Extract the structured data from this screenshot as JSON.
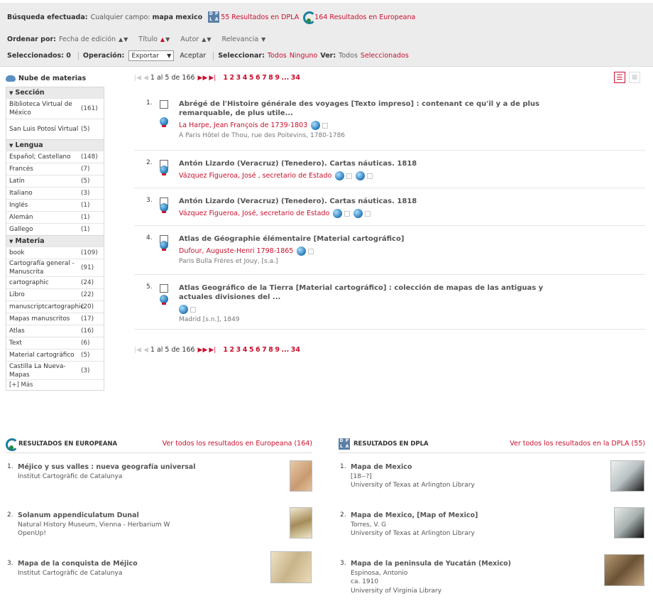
{
  "search": {
    "label": "Búsqueda efectuada:",
    "field": "Cualquier campo:",
    "term": "mapa mexico",
    "dpla_results": "55 Resultados en DPLA",
    "europeana_results": "164 Resultados en Europeana"
  },
  "sort": {
    "label": "Ordenar por:",
    "options": [
      "Fecha de edición",
      "Título",
      "Autor",
      "Relevancia"
    ]
  },
  "selection": {
    "selected_label": "Seleccionados: 0",
    "operation_label": "Operación:",
    "operation_value": "Exportar",
    "accept": "Aceptar",
    "select_label": "Seleccionar:",
    "all": "Todos",
    "none": "Ninguno",
    "view_label": "Ver:",
    "view_all": "Todos",
    "view_selected": "Seleccionados"
  },
  "sidebar": {
    "title": "Nube de materias",
    "sections": [
      {
        "title": "Sección",
        "items": [
          {
            "name": "Biblioteca Virtual de México",
            "count": "(161)"
          },
          {
            "name": "San Luis Potosí Virtual",
            "count": "(5)"
          }
        ]
      },
      {
        "title": "Lengua",
        "items": [
          {
            "name": "Español; Castellano",
            "count": "(148)"
          },
          {
            "name": "Francés",
            "count": "(7)"
          },
          {
            "name": "Latín",
            "count": "(5)"
          },
          {
            "name": "Italiano",
            "count": "(3)"
          },
          {
            "name": "Inglés",
            "count": "(1)"
          },
          {
            "name": "Alemán",
            "count": "(1)"
          },
          {
            "name": "Gallego",
            "count": "(1)"
          }
        ]
      },
      {
        "title": "Materia",
        "items": [
          {
            "name": "book",
            "count": "(109)"
          },
          {
            "name": "Cartografía general - Manuscrita",
            "count": "(91)"
          },
          {
            "name": "cartographic",
            "count": "(24)"
          },
          {
            "name": "Libro",
            "count": "(22)"
          },
          {
            "name": "manuscriptcartographic",
            "count": "(20)"
          },
          {
            "name": "Mapas manuscritos",
            "count": "(17)"
          },
          {
            "name": "Atlas",
            "count": "(16)"
          },
          {
            "name": "Text",
            "count": "(6)"
          },
          {
            "name": "Material cartográfico",
            "count": "(5)"
          },
          {
            "name": "Castilla La Nueva-Mapas",
            "count": "(3)"
          }
        ]
      }
    ],
    "more": "[+] Más"
  },
  "pagination": {
    "range": "1 al 5 de 166",
    "pages": [
      "1",
      "2",
      "3",
      "4",
      "5",
      "6",
      "7",
      "8",
      "9",
      "...",
      "34"
    ]
  },
  "results": [
    {
      "num": "1.",
      "title": "Abrégé de l'Histoire générale des voyages [Texto impreso] : contenant ce qu'il y a de plus remarquable, de plus utile...",
      "author": "La Harpe, Jean François de 1739-1803",
      "pub": "A Paris Hôtel de Thou, rue des Poitevins, 1780-1786"
    },
    {
      "num": "2.",
      "title": "Antón Lizardo (Veracruz) (Tenedero). Cartas náuticas. 1818",
      "author": "Vázquez Figueroa, José , secretario de Estado",
      "pub": ""
    },
    {
      "num": "3.",
      "title": "Antón Lizardo (Veracruz) (Tenedero). Cartas náuticas. 1818",
      "author": "Vázquez Figueroa, José, secretario de Estado",
      "pub": ""
    },
    {
      "num": "4.",
      "title": "Atlas de Géographie élémentaire [Material cartográfico]",
      "author": "Dufour, Auguste-Henri 1798-1865",
      "pub": "Paris Bulla Frères et Jouy, [s.a.]"
    },
    {
      "num": "5.",
      "title": "Atlas Geográfico de la Tierra [Material cartográfico] : colección de mapas de las antiguas y actuales divisiones del ...",
      "author": "",
      "pub": "Madrid [s.n.], 1849"
    }
  ],
  "europeana": {
    "title": "RESULTADOS EN EUROPEANA",
    "link": "Ver todos los resultados en Europeana (164)",
    "items": [
      {
        "num": "1.",
        "title": "Méjico y sus valles : nueva geografía universal",
        "lines": [
          "Institut Cartogràfic de Catalunya"
        ]
      },
      {
        "num": "2.",
        "title": "Solanum appendiculatum Dunal",
        "lines": [
          "Natural History Museum, Vienna - Herbarium W",
          "OpenUp!"
        ]
      },
      {
        "num": "3.",
        "title": "Mapa de la conquista de Méjico",
        "lines": [
          "Institut Cartogràfic de Catalunya"
        ]
      }
    ]
  },
  "dpla": {
    "title": "RESULTADOS EN DPLA",
    "link": "Ver todos los resultados en la DPLA (55)",
    "items": [
      {
        "num": "1.",
        "title": "Mapa de Mexico",
        "lines": [
          "[18--?]",
          "University of Texas at Arlington Library"
        ]
      },
      {
        "num": "2.",
        "title": "Mapa de Mexico, [Map of Mexico]",
        "lines": [
          "Torres, V. G",
          "University of Texas at Arlington Library"
        ]
      },
      {
        "num": "3.",
        "title": "Mapa de la peninsula de Yucatán (Mexico)",
        "lines": [
          "Espinosa, Antonio",
          "ca. 1910",
          "University of Virginia Library"
        ]
      }
    ]
  }
}
